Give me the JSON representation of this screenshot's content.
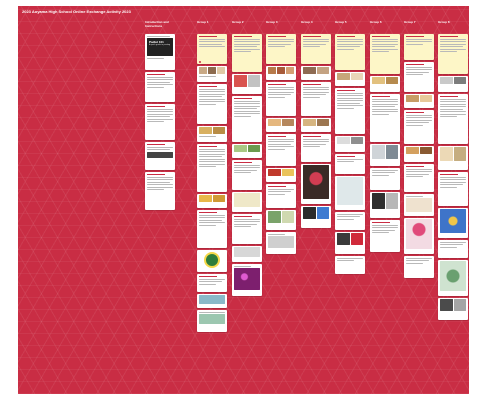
{
  "board": {
    "title": "2023 Aoyama High School Online Exchange Activity 2023",
    "subtitle": "",
    "background_color": "#c92d44"
  },
  "columns": [
    {
      "label": "Introduction and Instructions"
    },
    {
      "label": "Group 1"
    },
    {
      "label": "Group 2"
    },
    {
      "label": "Group 3"
    },
    {
      "label": "Group 4"
    },
    {
      "label": "Group 5"
    },
    {
      "label": "Group 6"
    },
    {
      "label": "Group 7"
    },
    {
      "label": "Group 8"
    }
  ],
  "intro_card": {
    "banner_text": "Padlet 101",
    "banner_sub": "A quick guide to posting"
  }
}
